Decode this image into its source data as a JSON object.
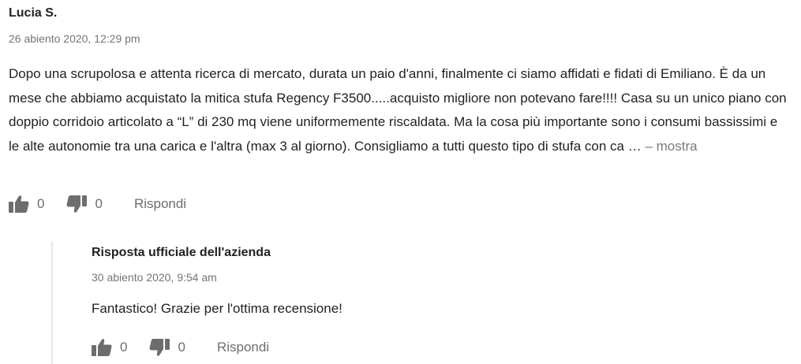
{
  "review": {
    "author": "Lucia S.",
    "date": "26 abiento 2020, 12:29 pm",
    "text": "Dopo una scrupolosa e attenta ricerca di mercato, durata un paio d'anni, finalmente ci siamo affidati e fidati di Emiliano. È da un mese che abbiamo acquistato la mitica stufa Regency F3500.....acquisto migliore non potevano fare!!!! Casa su un unico piano con doppio corridoio articolato a “L” di 230 mq viene uniformemente riscaldata. Ma la cosa più importante sono i consumi bassissimi e le alte autonomie tra una carica e l'altra (max 3 al giorno). Consigliamo a tutti questo tipo di stufa con ca …",
    "more_label": "– mostra",
    "likes": "0",
    "dislikes": "0",
    "reply_label": "Rispondi",
    "icons": {
      "like": "thumbs-up-icon",
      "dislike": "thumbs-down-icon"
    }
  },
  "reply": {
    "author": "Risposta ufficiale dell'azienda",
    "date": "30 abiento 2020, 9:54 am",
    "text": "Fantastico! Grazie per l'ottima recensione!",
    "likes": "0",
    "dislikes": "0",
    "reply_label": "Rispondi"
  },
  "colors": {
    "text": "#222222",
    "muted": "#757575",
    "icon": "#6d6d6d",
    "divider": "#e8e8e8"
  }
}
